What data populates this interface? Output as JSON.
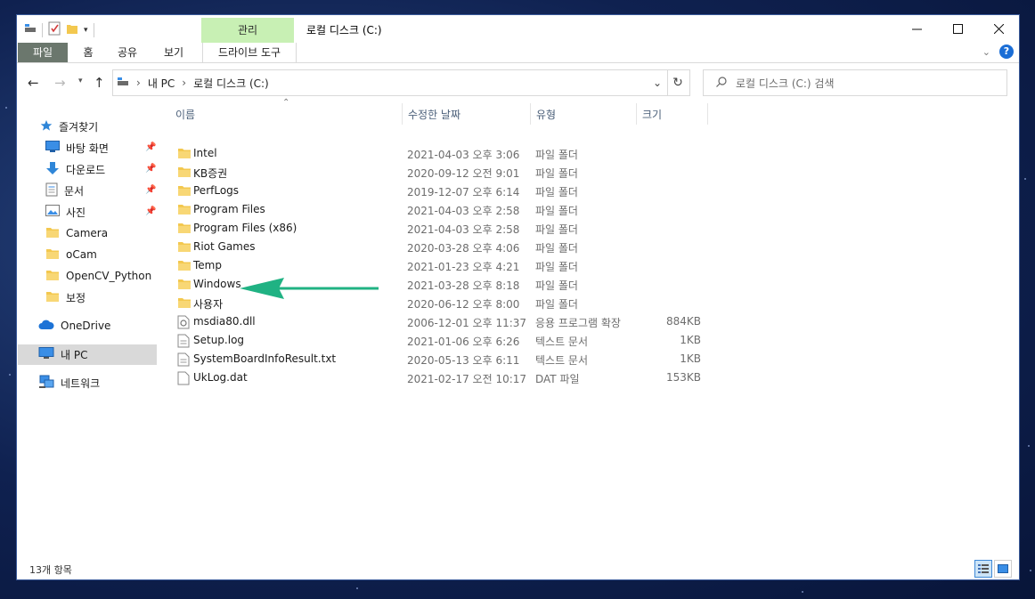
{
  "window": {
    "title": "로컬 디스크 (C:)",
    "manage_tab": "관리",
    "drive_tools_tab": "드라이브 도구"
  },
  "ribbon": {
    "tabs": [
      "파일",
      "홈",
      "공유",
      "보기"
    ]
  },
  "address": {
    "path": [
      "내 PC",
      "로컬 디스크 (C:)"
    ],
    "search_placeholder": "로컬 디스크 (C:) 검색"
  },
  "navigation": {
    "quick_access": "즐겨찾기",
    "items": [
      {
        "label": "바탕 화면",
        "icon": "desktop-icon",
        "pinned": true
      },
      {
        "label": "다운로드",
        "icon": "download-icon",
        "pinned": true
      },
      {
        "label": "문서",
        "icon": "document-icon",
        "pinned": true
      },
      {
        "label": "사진",
        "icon": "picture-icon",
        "pinned": true
      },
      {
        "label": "Camera",
        "icon": "folder-icon",
        "pinned": false
      },
      {
        "label": "oCam",
        "icon": "folder-icon",
        "pinned": false
      },
      {
        "label": "OpenCV_Python",
        "icon": "folder-icon",
        "pinned": false
      },
      {
        "label": "보정",
        "icon": "folder-icon",
        "pinned": false
      }
    ],
    "onedrive": "OneDrive",
    "this_pc": "내 PC",
    "network": "네트워크"
  },
  "columns": {
    "name": "이름",
    "date": "수정한 날짜",
    "type": "유형",
    "size": "크기"
  },
  "files": [
    {
      "name": "Intel",
      "date": "2021-04-03 오후 3:06",
      "type": "파일 폴더",
      "size": "",
      "icon": "folder"
    },
    {
      "name": "KB증권",
      "date": "2020-09-12 오전 9:01",
      "type": "파일 폴더",
      "size": "",
      "icon": "folder"
    },
    {
      "name": "PerfLogs",
      "date": "2019-12-07 오후 6:14",
      "type": "파일 폴더",
      "size": "",
      "icon": "folder"
    },
    {
      "name": "Program Files",
      "date": "2021-04-03 오후 2:58",
      "type": "파일 폴더",
      "size": "",
      "icon": "folder"
    },
    {
      "name": "Program Files (x86)",
      "date": "2021-04-03 오후 2:58",
      "type": "파일 폴더",
      "size": "",
      "icon": "folder"
    },
    {
      "name": "Riot Games",
      "date": "2020-03-28 오후 4:06",
      "type": "파일 폴더",
      "size": "",
      "icon": "folder"
    },
    {
      "name": "Temp",
      "date": "2021-01-23 오후 4:21",
      "type": "파일 폴더",
      "size": "",
      "icon": "folder"
    },
    {
      "name": "Windows",
      "date": "2021-03-28 오후 8:18",
      "type": "파일 폴더",
      "size": "",
      "icon": "folder"
    },
    {
      "name": "사용자",
      "date": "2020-06-12 오후 8:00",
      "type": "파일 폴더",
      "size": "",
      "icon": "folder"
    },
    {
      "name": "msdia80.dll",
      "date": "2006-12-01 오후 11:37",
      "type": "응용 프로그램 확장",
      "size": "884KB",
      "icon": "dll"
    },
    {
      "name": "Setup.log",
      "date": "2021-01-06 오후 6:26",
      "type": "텍스트 문서",
      "size": "1KB",
      "icon": "text"
    },
    {
      "name": "SystemBoardInfoResult.txt",
      "date": "2020-05-13 오후 6:11",
      "type": "텍스트 문서",
      "size": "1KB",
      "icon": "text"
    },
    {
      "name": "UkLog.dat",
      "date": "2021-02-17 오전 10:17",
      "type": "DAT 파일",
      "size": "153KB",
      "icon": "file"
    }
  ],
  "status": {
    "item_count": "13개 항목"
  },
  "colors": {
    "manage_tab": "#c8f0b4",
    "annotation_arrow": "#20b283",
    "selection": "#d9d9d9",
    "folder": "#f3c84f"
  }
}
